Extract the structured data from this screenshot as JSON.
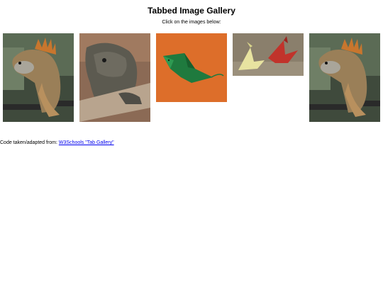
{
  "page": {
    "title": "Tabbed Image Gallery",
    "instruction": "Click on the images below:"
  },
  "gallery": {
    "images": [
      {
        "subject": "iguana on branch"
      },
      {
        "subject": "lizard close-up on rock"
      },
      {
        "subject": "green origami mouse on orange background"
      },
      {
        "subject": "origami cranes yellow and red"
      },
      {
        "subject": "iguana on branch"
      }
    ]
  },
  "footer": {
    "prefix": "Code taken/adapted from: ",
    "link_text": "W3Schools \"Tab Gallery\""
  }
}
